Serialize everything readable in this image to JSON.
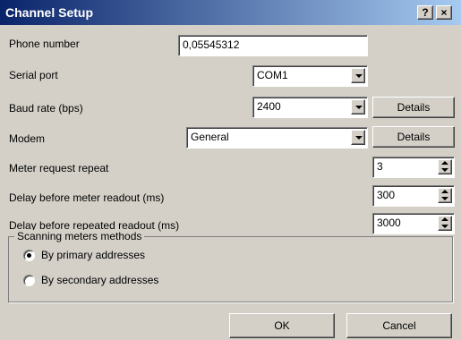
{
  "window": {
    "title": "Channel Setup",
    "help_label": "?",
    "close_label": "×"
  },
  "fields": {
    "phone": {
      "label": "Phone number",
      "value": "0,05545312"
    },
    "serial": {
      "label": "Serial port",
      "value": "COM1"
    },
    "baud": {
      "label": "Baud rate (bps)",
      "value": "2400",
      "details_label": "Details"
    },
    "modem": {
      "label": "Modem",
      "value": "General",
      "details_label": "Details"
    },
    "repeat": {
      "label": "Meter request repeat",
      "value": "3"
    },
    "delay": {
      "label": "Delay before meter readout (ms)",
      "value": "300"
    },
    "delay_repeat": {
      "label": "Delay before repeated readout (ms)",
      "value": "3000"
    }
  },
  "scanning": {
    "title": "Scanning meters methods",
    "options": [
      {
        "label": "By primary addresses",
        "checked": true
      },
      {
        "label": "By secondary addresses",
        "checked": false
      }
    ]
  },
  "buttons": {
    "ok": "OK",
    "cancel": "Cancel"
  }
}
